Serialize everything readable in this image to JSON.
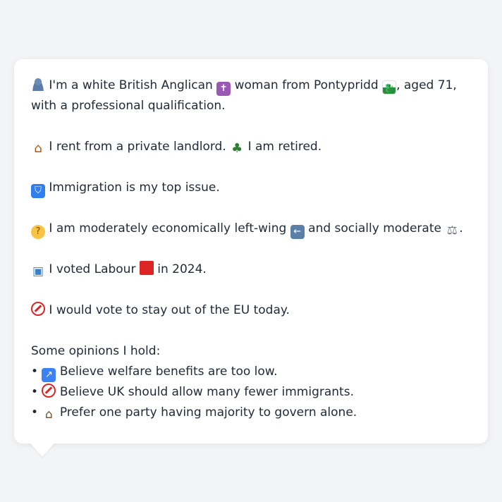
{
  "profile": {
    "line1": {
      "prefix_icon": "person-silhouette-icon",
      "t1": "I'm a white British Anglican",
      "icon2": "latin-cross-icon",
      "t2": "woman from Pontypridd",
      "icon3": "wales-flag-icon",
      "t3": ", aged 71, with a professional qualification."
    },
    "line2": {
      "icon1": "house-icon",
      "t1": "I rent from a private landlord.",
      "icon2": "palm-tree-icon",
      "t2": "I am retired."
    },
    "line3": {
      "icon1": "passport-control-icon",
      "t1": "Immigration is my top issue."
    },
    "line4": {
      "icon1": "thinking-face-icon",
      "t1": "I am moderately economically left-wing",
      "icon2": "left-arrow-icon",
      "t2": "and socially moderate",
      "icon3": "balance-scale-icon",
      "t3": "."
    },
    "line5": {
      "icon1": "ballot-box-icon",
      "t1": "I voted Labour",
      "icon2": "red-square-icon",
      "t2": "in 2024."
    },
    "line6": {
      "icon1": "prohibited-icon",
      "t1": "I would vote to stay out of the EU today."
    },
    "opinions_heading": "Some opinions I hold:",
    "opinions": [
      {
        "bullet": "•",
        "icon": "up-right-arrow-icon",
        "text": "Believe welfare benefits are too low."
      },
      {
        "bullet": "•",
        "icon": "prohibited-icon",
        "text": "Believe UK should allow many fewer immigrants."
      },
      {
        "bullet": "•",
        "icon": "classical-building-icon",
        "text": "Prefer one party having majority to govern alone."
      }
    ]
  },
  "colors": {
    "background": "#f3f4f6",
    "card": "#ffffff",
    "text": "#1f2937"
  }
}
